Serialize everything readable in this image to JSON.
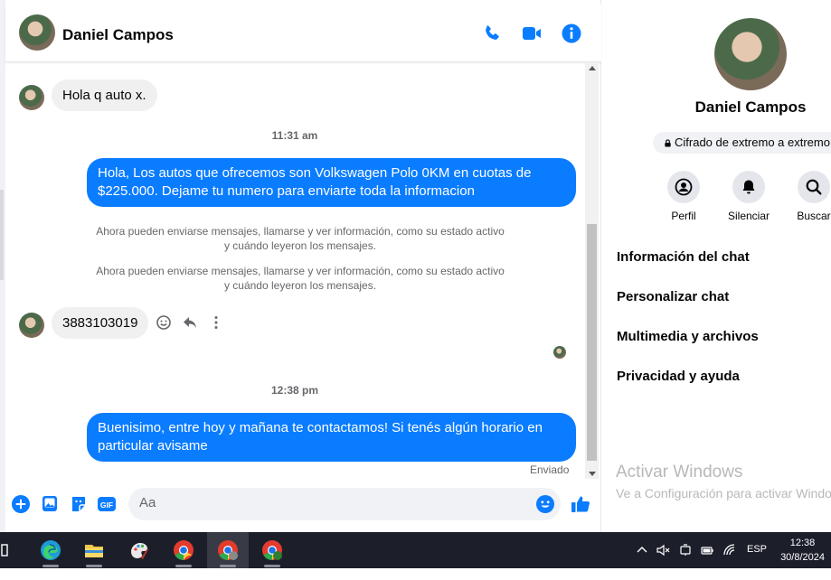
{
  "header": {
    "contact_name": "Daniel Campos",
    "icons": [
      "phone-icon",
      "video-icon",
      "info-icon"
    ]
  },
  "messages": {
    "incoming_1": "Hola q auto x.",
    "time_1": "11:31 am",
    "outgoing_1": "Hola, Los autos que ofrecemos son Volkswagen Polo 0KM en cuotas de $225.000. Dejame tu numero para enviarte toda la informacion",
    "system_1": "Ahora pueden enviarse mensajes, llamarse y ver información, como su estado activo y cuándo leyeron los mensajes.",
    "system_2": "Ahora pueden enviarse mensajes, llamarse y ver información, como su estado activo y cuándo leyeron los mensajes.",
    "incoming_2": "3883103019",
    "time_2": "12:38 pm",
    "outgoing_2": "Buenisimo, entre hoy y mañana te contactamos! Si tenés algún horario en particular avisame",
    "status": "Enviado"
  },
  "composer": {
    "placeholder": "Aa",
    "icons": [
      "plus-icon",
      "gallery-icon",
      "sticker-icon",
      "gif-icon",
      "emoji-icon",
      "like-icon"
    ]
  },
  "info_panel": {
    "name": "Daniel Campos",
    "encryption": "Cifrado de extremo a extremo",
    "actions": [
      {
        "label": "Perfil",
        "icon": "profile-icon"
      },
      {
        "label": "Silenciar",
        "icon": "bell-icon"
      },
      {
        "label": "Buscar",
        "icon": "search-icon"
      }
    ],
    "menu": [
      "Información del chat",
      "Personalizar chat",
      "Multimedia y archivos",
      "Privacidad y ayuda"
    ]
  },
  "watermark": {
    "line1": "Activar Windows",
    "line2": "Ve a Configuración para activar Windows."
  },
  "taskbar": {
    "language": "ESP",
    "time": "12:38",
    "date": "30/8/2024"
  },
  "colors": {
    "accent": "#0a7cff",
    "taskbar": "#1c1f2a"
  }
}
